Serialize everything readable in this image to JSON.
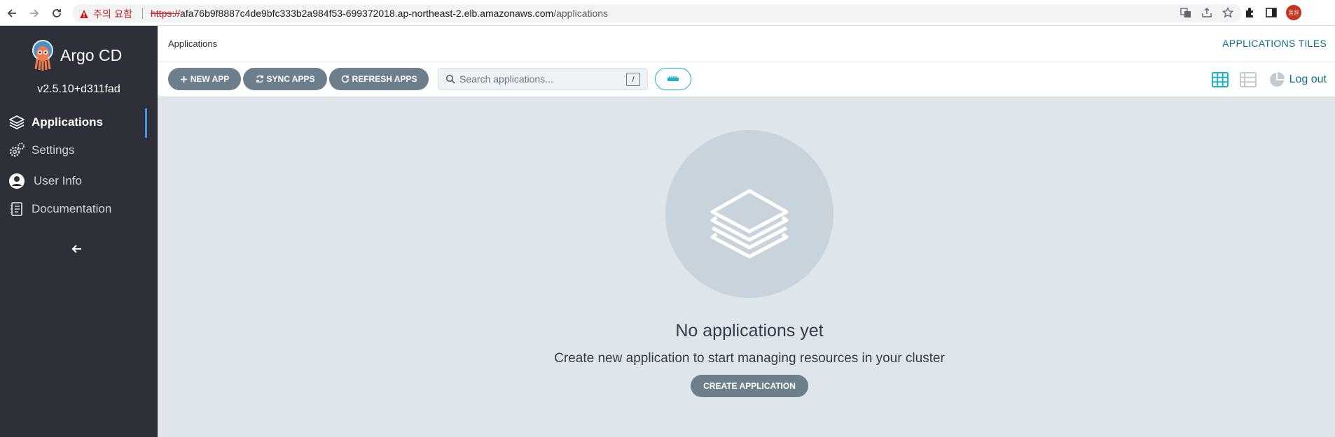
{
  "browser": {
    "warning_label": "주의 요함",
    "url_scheme": "https://",
    "url_host": "afa76b9f8887c4de9bfc333b2a984f53-699372018.ap-northeast-2.elb.amazonaws.com",
    "url_path": "/applications",
    "avatar_label": "동원"
  },
  "sidebar": {
    "logo_text": "Argo CD",
    "version": "v2.5.10+d311fad",
    "items": [
      {
        "label": "Applications",
        "icon": "layers-icon",
        "active": true
      },
      {
        "label": "Settings",
        "icon": "gears-icon",
        "active": false
      },
      {
        "label": "User Info",
        "icon": "user-circle-icon",
        "active": false
      },
      {
        "label": "Documentation",
        "icon": "book-icon",
        "active": false
      }
    ]
  },
  "header": {
    "breadcrumb": "Applications",
    "title": "APPLICATIONS TILES"
  },
  "toolbar": {
    "new_app": "NEW APP",
    "sync_apps": "SYNC APPS",
    "refresh_apps": "REFRESH APPS",
    "search_placeholder": "Search applications...",
    "search_shortcut": "/",
    "logout": "Log out"
  },
  "empty_state": {
    "title": "No applications yet",
    "subtitle": "Create new application to start managing resources in your cluster",
    "button": "CREATE APPLICATION"
  },
  "colors": {
    "sidebar_bg": "#2d3039",
    "accent": "#0f6e8a",
    "button_bg": "#6d7f8b",
    "content_bg": "#dee6eb",
    "filter_accent": "#1db4c9",
    "active_indicator": "#4f8edb"
  }
}
